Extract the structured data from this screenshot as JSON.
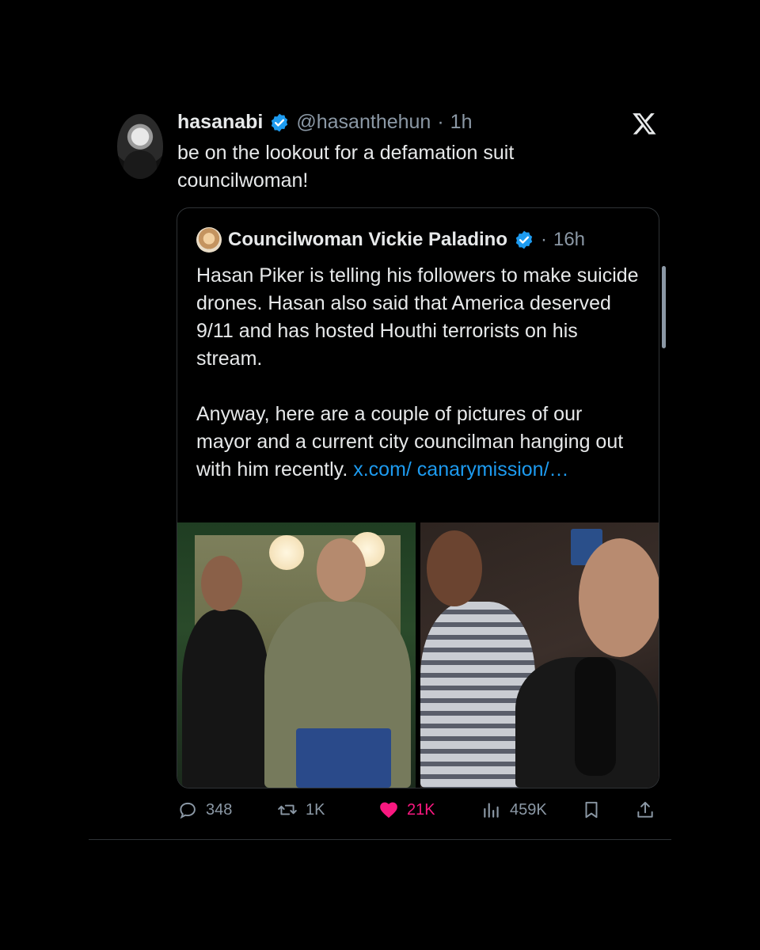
{
  "tweet": {
    "display_name": "hasanabi",
    "handle": "@hasanthehun",
    "separator": "·",
    "time": "1h",
    "text": "be on the lookout for a defamation suit councilwoman!"
  },
  "quoted": {
    "display_name": "Councilwoman Vickie Paladino",
    "separator": "·",
    "time": "16h",
    "paragraph1": "Hasan Piker is telling his followers to make suicide drones. Hasan also said that America deserved 9/11 and has hosted Houthi terrorists on his stream.",
    "paragraph2": "Anyway, here are a couple of pictures of our mayor and a current city councilman hanging out with him recently.",
    "link_text": "x.com/ canarymission/…"
  },
  "actions": {
    "replies": "348",
    "reposts": "1K",
    "likes": "21K",
    "views": "459K"
  },
  "colors": {
    "background": "#000000",
    "text": "#e7e9ea",
    "muted": "#8b98a5",
    "link": "#1d9bf0",
    "like": "#f91880",
    "verified": "#1d9bf0"
  },
  "icons": [
    "x-logo-icon",
    "verified-badge-icon",
    "reply-icon",
    "repost-icon",
    "heart-icon",
    "views-icon",
    "bookmark-icon",
    "share-icon"
  ]
}
